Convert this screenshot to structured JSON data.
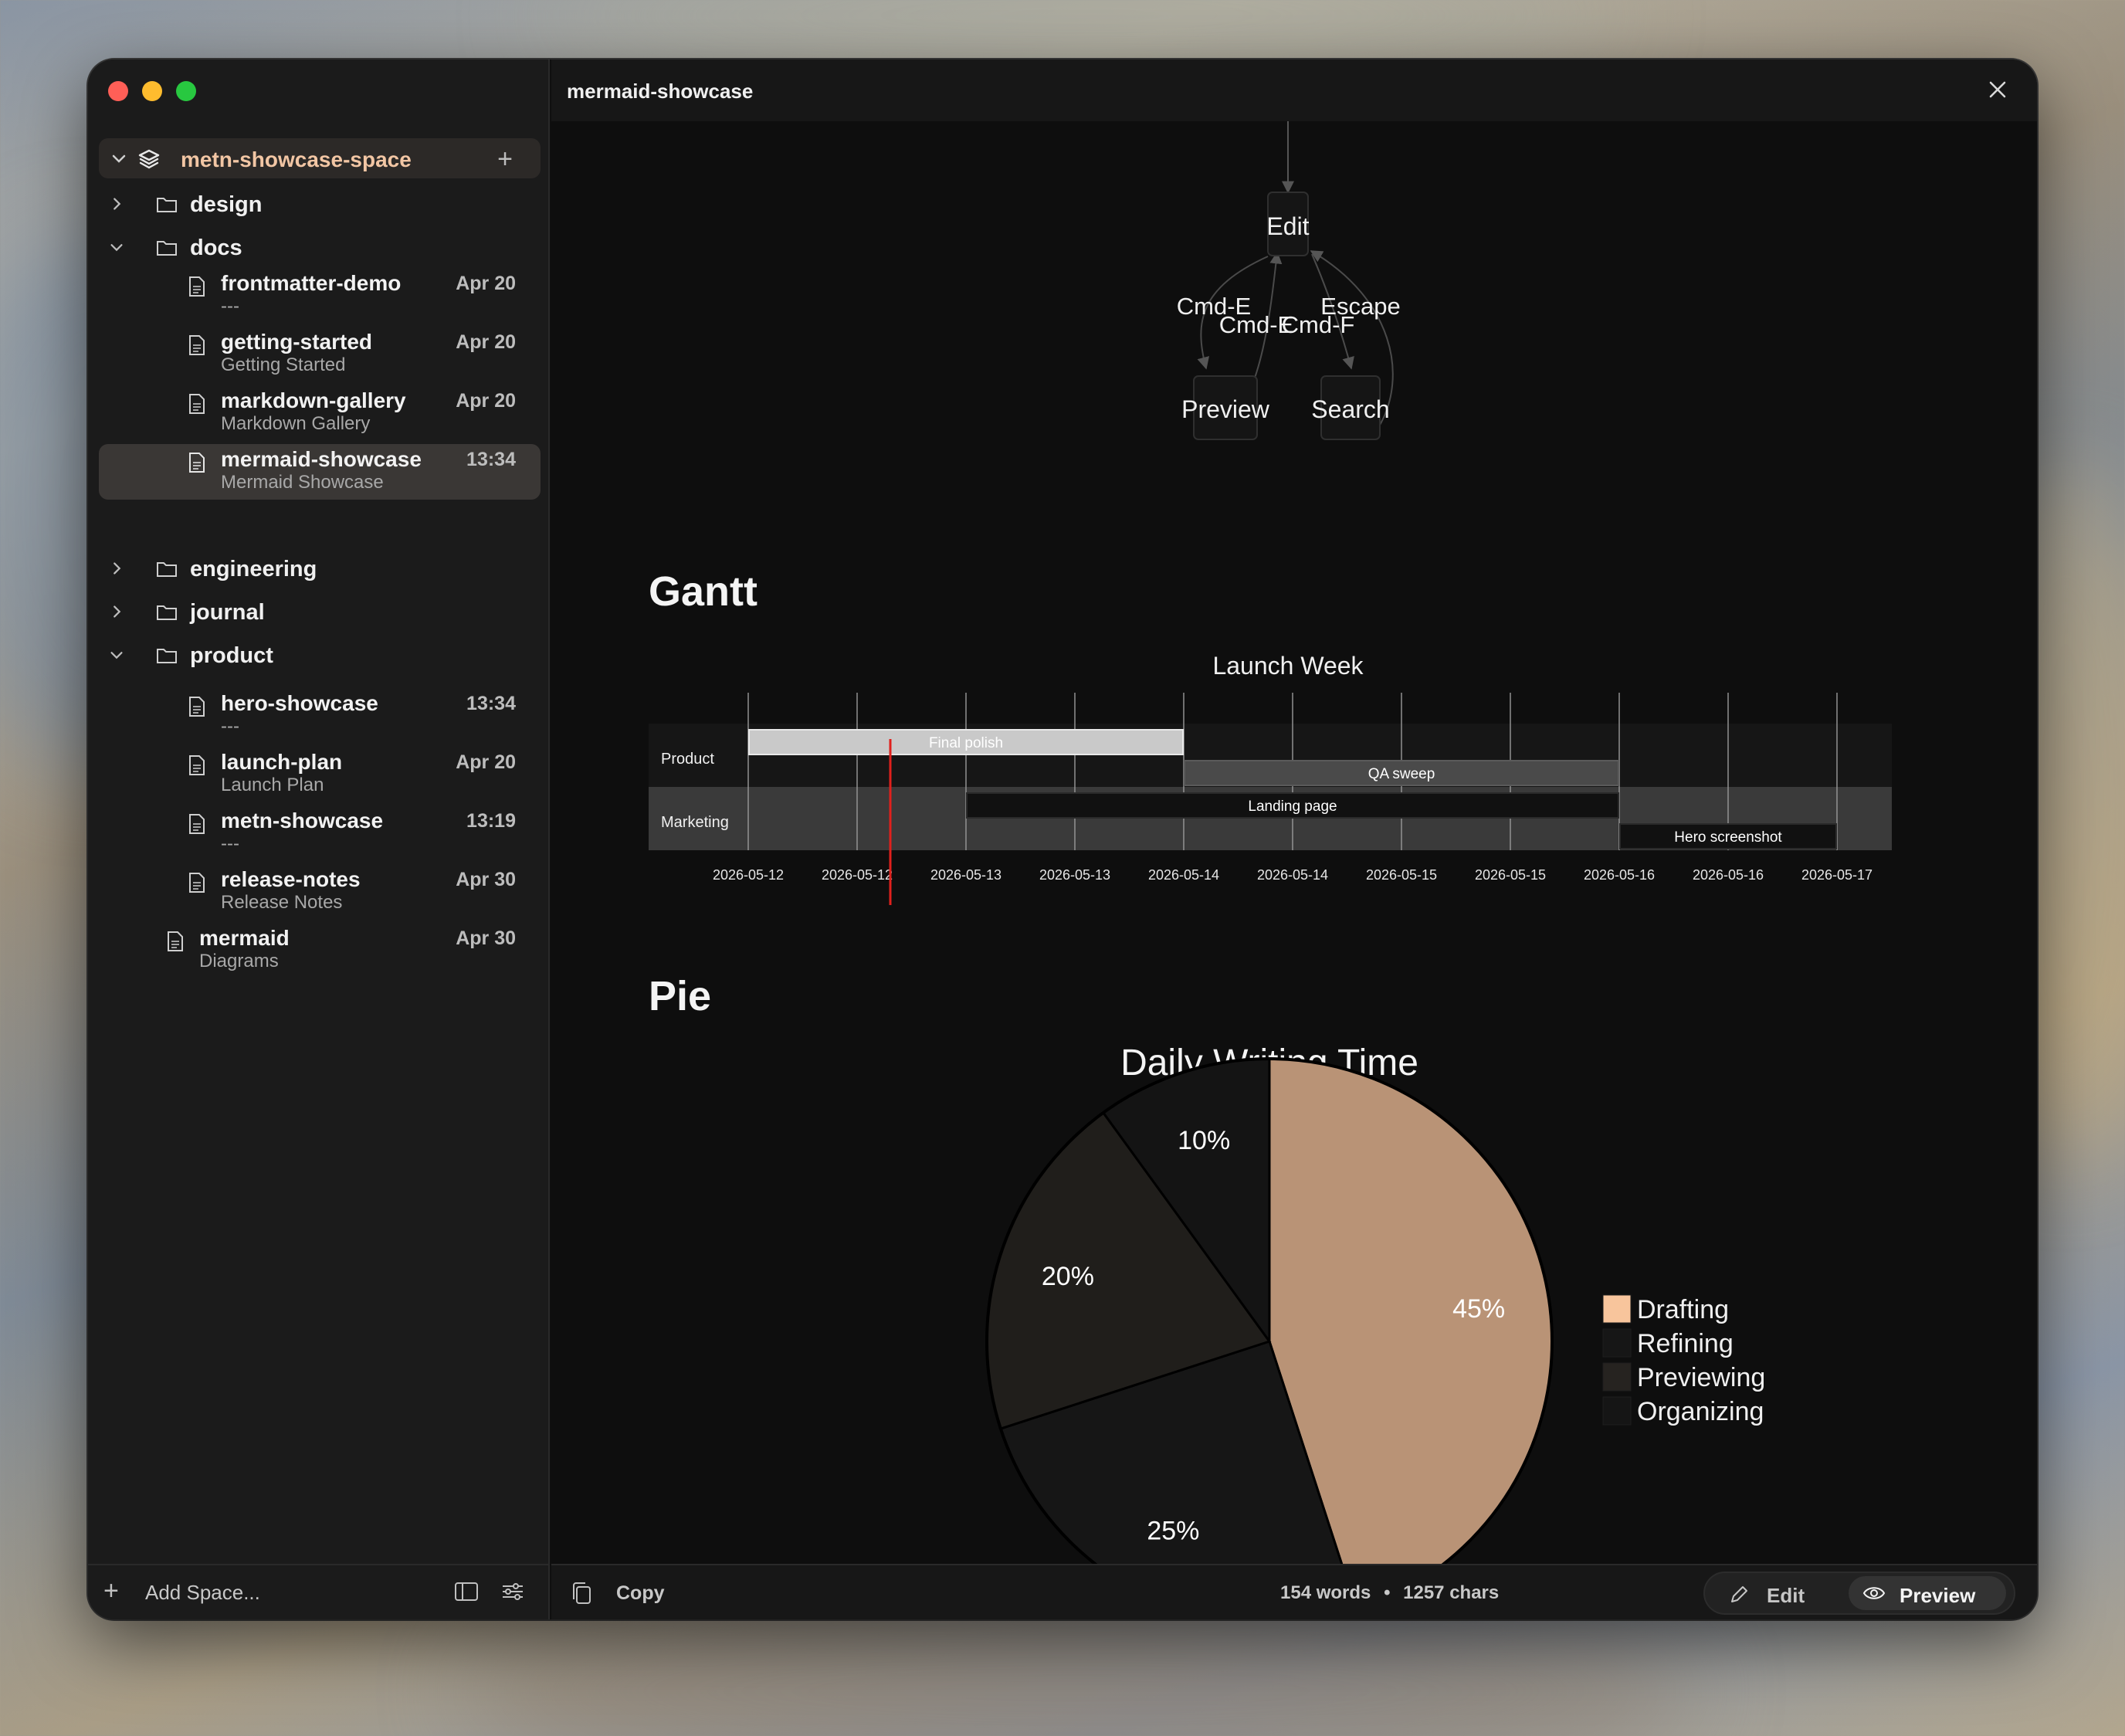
{
  "window": {
    "title": "mermaid-showcase"
  },
  "sidebar": {
    "space": {
      "name": "metn-showcase-space"
    },
    "folders": [
      {
        "label": "design"
      },
      {
        "label": "docs"
      },
      {
        "label": "engineering"
      },
      {
        "label": "journal"
      },
      {
        "label": "product"
      }
    ],
    "files": [
      {
        "title": "frontmatter-demo",
        "subtitle": "---",
        "date": "Apr 20"
      },
      {
        "title": "getting-started",
        "subtitle": "Getting Started",
        "date": "Apr 20"
      },
      {
        "title": "markdown-gallery",
        "subtitle": "Markdown Gallery",
        "date": "Apr 20"
      },
      {
        "title": "mermaid-showcase",
        "subtitle": "Mermaid Showcase",
        "date": "13:34"
      },
      {
        "title": "hero-showcase",
        "subtitle": "---",
        "date": "13:34"
      },
      {
        "title": "launch-plan",
        "subtitle": "Launch Plan",
        "date": "Apr 20"
      },
      {
        "title": "metn-showcase",
        "subtitle": "---",
        "date": "13:19"
      },
      {
        "title": "release-notes",
        "subtitle": "Release Notes",
        "date": "Apr 30"
      },
      {
        "title": "mermaid",
        "subtitle": "Diagrams",
        "date": "Apr 30"
      }
    ],
    "footer": {
      "add_space_label": "Add Space..."
    }
  },
  "diagram": {
    "nodes": {
      "edit": "Edit",
      "preview": "Preview",
      "search": "Search"
    },
    "edges": [
      "Cmd-E",
      "Cmd-E",
      "Cmd-F",
      "Escape"
    ]
  },
  "sections": {
    "gantt": "Gantt",
    "pie": "Pie"
  },
  "chart_data": [
    {
      "type": "gantt",
      "title": "Launch Week",
      "sections": [
        "Product",
        "Marketing"
      ],
      "tasks": [
        {
          "name": "Final polish",
          "section": "Product",
          "start": "2026-05-12",
          "end": "2026-05-14"
        },
        {
          "name": "QA sweep",
          "section": "Product",
          "start": "2026-05-14",
          "end": "2026-05-16"
        },
        {
          "name": "Landing page",
          "section": "Marketing",
          "start": "2026-05-13",
          "end": "2026-05-16"
        },
        {
          "name": "Hero screenshot",
          "section": "Marketing",
          "start": "2026-05-16",
          "end": "2026-05-17"
        }
      ],
      "tick_labels": [
        "2026-05-12",
        "2026-05-12",
        "2026-05-13",
        "2026-05-13",
        "2026-05-14",
        "2026-05-14",
        "2026-05-15",
        "2026-05-15",
        "2026-05-16",
        "2026-05-16",
        "2026-05-17"
      ],
      "today_marker_color": "#e0201c"
    },
    {
      "type": "pie",
      "title": "Daily Writing Time",
      "labels": [
        "Drafting",
        "Refining",
        "Previewing",
        "Organizing"
      ],
      "values": [
        45,
        25,
        20,
        10
      ],
      "value_labels": [
        "45%",
        "25%",
        "20%",
        "10%"
      ],
      "colors": [
        "#b99376",
        "#161616",
        "#201e1b",
        "#141414"
      ],
      "legend_colors": [
        "#f8c59c",
        "#161616",
        "#262320",
        "#151515"
      ],
      "legend_position": "right"
    }
  ],
  "footer": {
    "copy_label": "Copy",
    "words": "154 words",
    "separator": "•",
    "chars": "1257 chars",
    "edit_label": "Edit",
    "preview_label": "Preview"
  },
  "colors": {
    "accent": "#f2c6a4",
    "selected_row": "#3a3735"
  }
}
